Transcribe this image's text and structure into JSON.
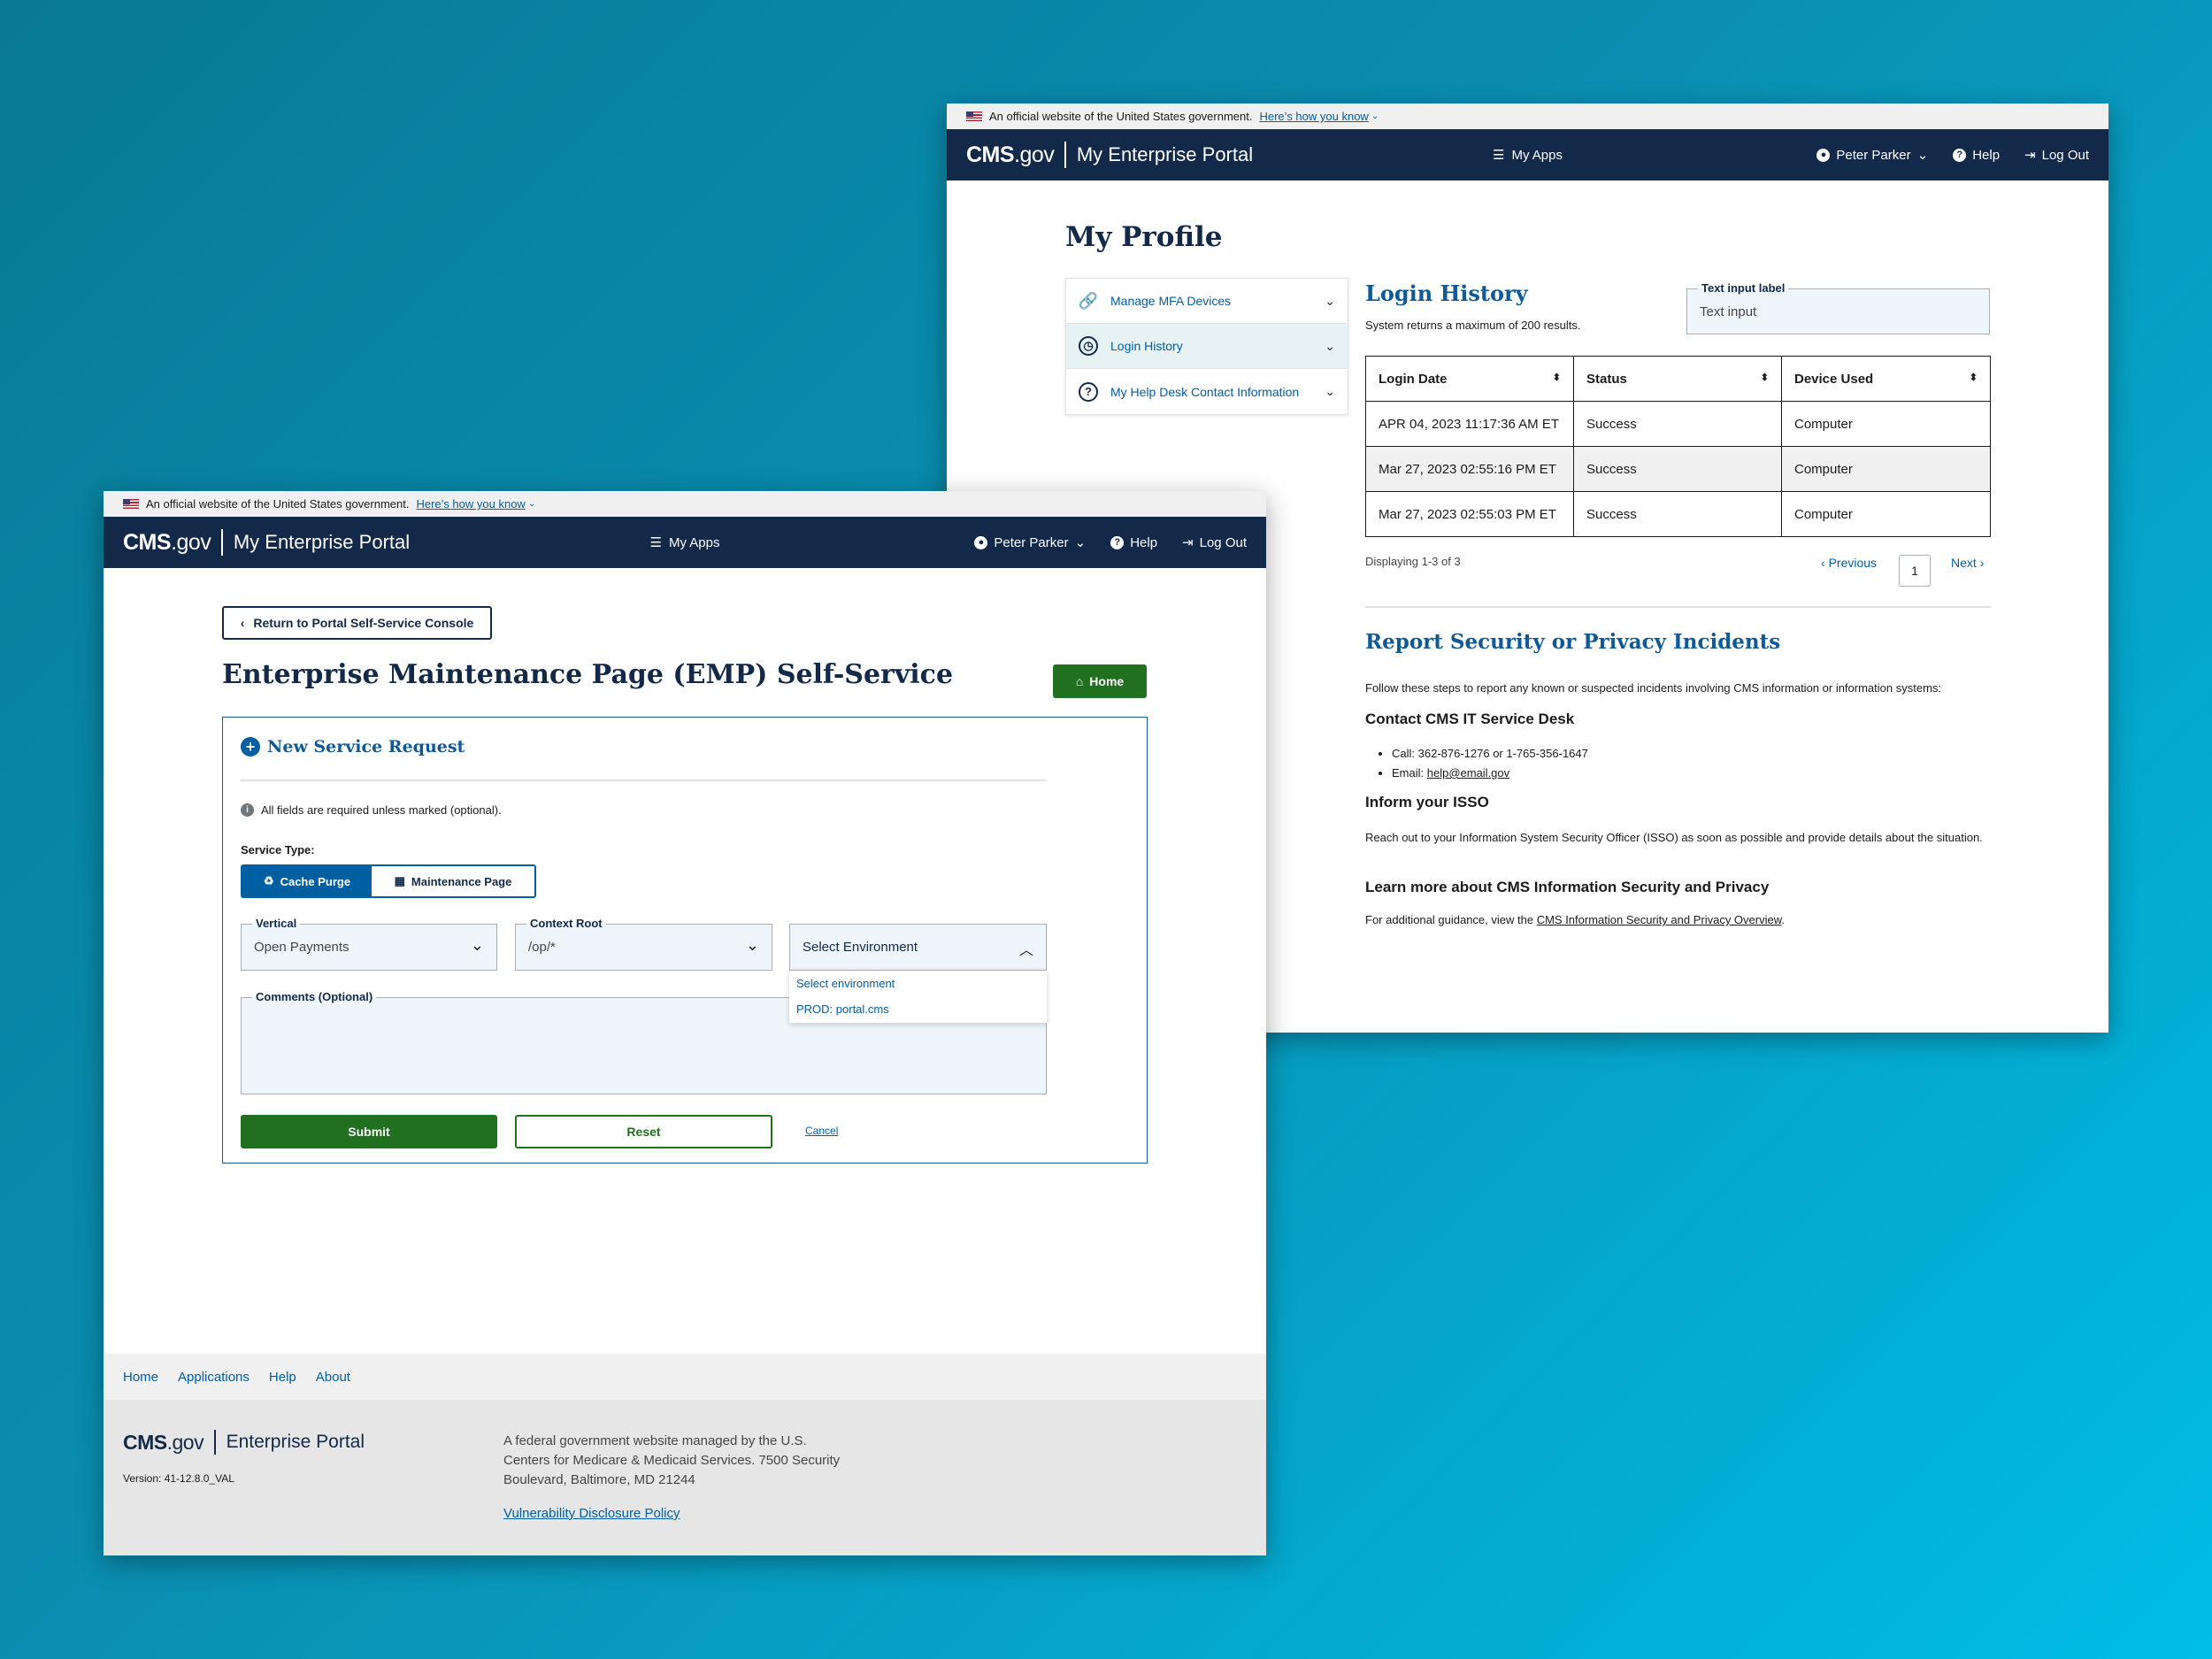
{
  "gov_banner": {
    "text": "An official website of the United States government.",
    "link": "Here’s how you know"
  },
  "header": {
    "logo_bold": "CMS",
    "logo_rest": ".gov",
    "portal_title": "My Enterprise Portal",
    "my_apps": "My Apps",
    "user": "Peter Parker",
    "help": "Help",
    "logout": "Log Out"
  },
  "profile": {
    "title": "My Profile",
    "menu": [
      {
        "label": "Manage MFA Devices"
      },
      {
        "label": "Login History"
      },
      {
        "label": "My Help Desk Contact Information"
      }
    ],
    "login_history": {
      "title": "Login History",
      "subtitle": "System returns a maximum of 200 results.",
      "text_input_label": "Text input label",
      "text_input_value": "Text input",
      "columns": [
        "Login Date",
        "Status",
        "Device Used"
      ],
      "rows": [
        [
          "APR 04, 2023 11:17:36 AM ET",
          "Success",
          "Computer"
        ],
        [
          "Mar 27, 2023 02:55:16 PM ET",
          "Success",
          "Computer"
        ],
        [
          "Mar 27, 2023 02:55:03 PM ET",
          "Success",
          "Computer"
        ]
      ],
      "displaying": "Displaying 1-3 of 3",
      "previous": "Previous",
      "page": "1",
      "next": "Next"
    },
    "report": {
      "title": "Report Security or Privacy Incidents",
      "intro": "Follow these steps to report any known or suspected incidents involving CMS information or information systems:",
      "contact_title": "Contact CMS IT Service Desk",
      "call": "Call: 362-876-1276 or 1-765-356-1647",
      "email_label": "Email: ",
      "email": "help@email.gov",
      "isso_title": "Inform your ISSO",
      "isso_text": "Reach out to your Information System Security Officer (ISSO) as soon as possible and provide details about the situation.",
      "learn_title": "Learn more about CMS Information Security and Privacy",
      "learn_text": "For additional guidance, view the ",
      "learn_link": "CMS Information Security and Privacy Overview",
      "learn_end": "."
    }
  },
  "emp": {
    "back_button": "Return to Portal Self-Service Console",
    "title": "Enterprise Maintenance Page (EMP) Self-Service",
    "home_button": "Home",
    "form_title": "New Service Request",
    "required_note": "All fields are required unless marked (optional).",
    "service_type_label": "Service Type:",
    "service_types": [
      "Cache Purge",
      "Maintenance Page"
    ],
    "vertical_label": "Vertical",
    "vertical_value": "Open Payments",
    "context_root_label": "Context Root",
    "context_root_value": "/op/*",
    "environment_placeholder": "Select Environment",
    "environment_options": [
      "Select environment",
      "PROD: portal.cms"
    ],
    "comments_label": "Comments (Optional)",
    "submit": "Submit",
    "reset": "Reset",
    "cancel": "Cancel"
  },
  "footer": {
    "nav": [
      "Home",
      "Applications",
      "Help",
      "About"
    ],
    "portal": "Enterprise Portal",
    "version": "Version: 41-12.8.0_VAL",
    "address": "A federal government website managed by the U.S. Centers for Medicare & Medicaid Services. 7500 Security Boulevard, Baltimore, MD 21244",
    "vdp": "Vulnerability Disclosure Policy"
  },
  "colors": {
    "navy": "#12294a",
    "blue": "#005ea2",
    "green": "#20701f"
  }
}
